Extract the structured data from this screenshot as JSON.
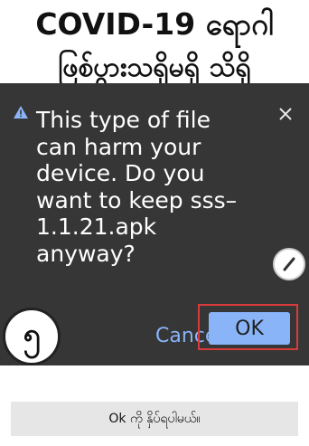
{
  "header": {
    "title_line1": "COVID-19 ရောဂါ",
    "title_line2": "ဖြစ်ပွားသရှိမရှိ သိရှိ"
  },
  "dialog": {
    "warning_icon": "warning-triangle-icon",
    "message": "This type of file can harm your device. Do you want to keep sss–1.1.21.apk anyway?",
    "cancel_label": "Cancel",
    "ok_label": "OK",
    "close_icon": "close-icon",
    "pen_icon": "pen-icon"
  },
  "step": {
    "number": "၅"
  },
  "caption": {
    "text": "Ok ကို နှိပ်ရပါမယ်။"
  },
  "colors": {
    "dialog_bg": "#363636",
    "accent": "#8ab4f8",
    "highlight_border": "#d93a3a",
    "caption_bg": "#e6e6e6"
  }
}
